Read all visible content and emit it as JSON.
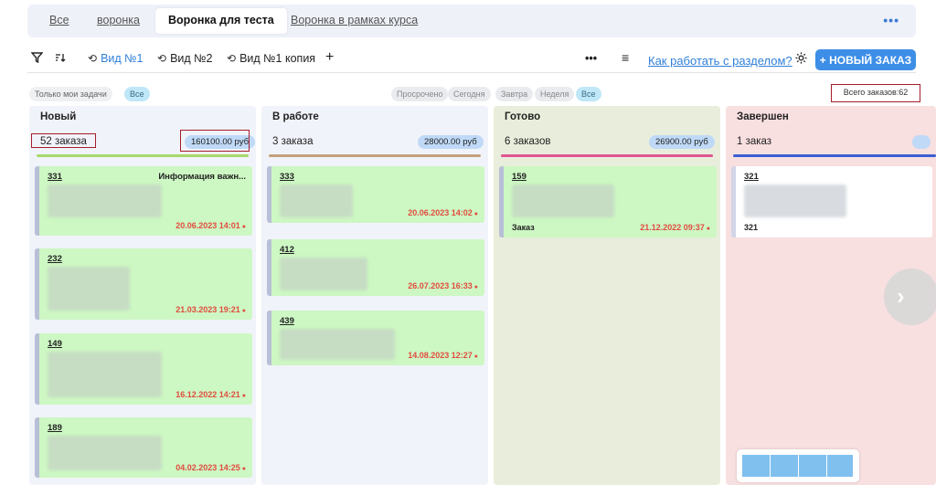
{
  "tabs": {
    "items": [
      {
        "label": "Все"
      },
      {
        "label": "воронка"
      },
      {
        "label": "Воронка для теста",
        "active": true
      },
      {
        "label": "Воронка в рамках курса"
      }
    ],
    "more": "•••"
  },
  "toolbar": {
    "filter_icon": "filter-icon",
    "sort_icon": "sort-icon",
    "views": [
      {
        "label": "Вид №1",
        "active": true
      },
      {
        "label": "Вид №2"
      },
      {
        "label": "Вид №1 копия"
      }
    ],
    "add": "+",
    "more": "•••",
    "menu": "≡",
    "help_link": "Как работать с разделом?",
    "settings_icon": "gear-icon",
    "new_order": "+ НОВЫЙ ЗАКАЗ"
  },
  "filters": {
    "my_tasks": "Только мои задачи",
    "all_left": "Все",
    "date_chips": [
      "Просрочено",
      "Сегодня",
      "Завтра",
      "Неделя",
      "Все"
    ],
    "total": "Всего заказов:62"
  },
  "columns": [
    {
      "title": "Новый",
      "count": "52 заказа",
      "sum": "160100.00 руб",
      "color": "#a7d96c",
      "cards": [
        {
          "num": "331",
          "info": "Информация важн...",
          "date": "20.06.2023 14:01"
        },
        {
          "num": "232",
          "date": "21.03.2023 19:21"
        },
        {
          "num": "149",
          "date": "16.12.2022 14:21"
        },
        {
          "num": "189",
          "date": "04.02.2023 14:25"
        }
      ]
    },
    {
      "title": "В работе",
      "count": "3 заказа",
      "sum": "28000.00 руб",
      "color": "#c4a07a",
      "cards": [
        {
          "num": "333",
          "date": "20.06.2023 14:02"
        },
        {
          "num": "412",
          "date": "26.07.2023 16:33"
        },
        {
          "num": "439",
          "date": "14.08.2023 12:27"
        }
      ]
    },
    {
      "title": "Готово",
      "count": "6 заказов",
      "sum": "26900.00 руб",
      "color": "#e0558f",
      "cards": [
        {
          "num": "159",
          "label": "Заказ",
          "date": "21.12.2022 09:37"
        }
      ]
    },
    {
      "title": "Завершен",
      "count": "1 заказ",
      "color": "#3a5fd3",
      "cards": [
        {
          "num": "321",
          "label": "321"
        }
      ]
    }
  ]
}
